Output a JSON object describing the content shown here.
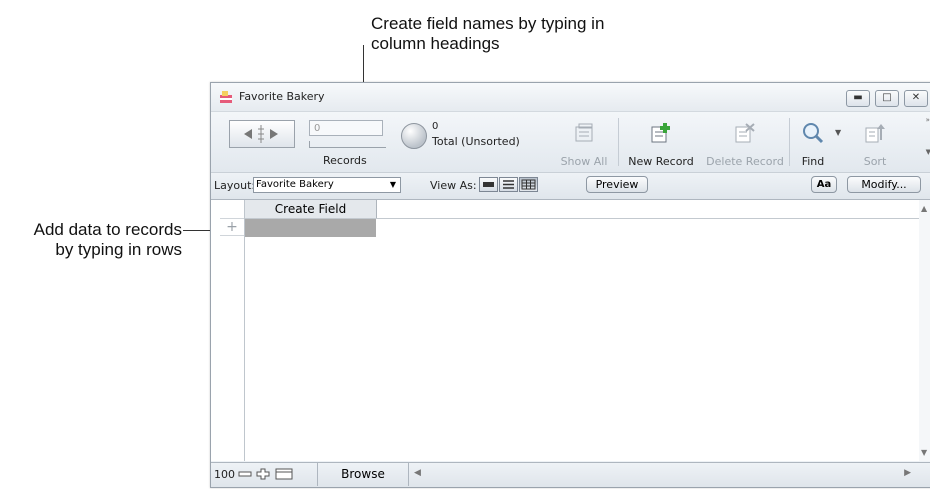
{
  "annotations": {
    "top_line1": "Create field names by typing in",
    "top_line2": "column headings",
    "left_line1": "Add data to records",
    "left_line2": "by typing in rows"
  },
  "window": {
    "title": "Favorite Bakery",
    "controls": [
      "minimize-icon",
      "maximize-icon",
      "close-icon"
    ]
  },
  "toolbar": {
    "record_field_value": "0",
    "records_label": "Records",
    "found_count": "0",
    "found_status": "Total (Unsorted)",
    "show_all": "Show All",
    "new_record": "New Record",
    "delete_record": "Delete Record",
    "find": "Find",
    "sort": "Sort"
  },
  "layoutbar": {
    "layout_label": "Layout:",
    "layout_value": "Favorite Bakery",
    "view_as_label": "View As:",
    "preview": "Preview",
    "format_button": "Aa",
    "modify": "Modify..."
  },
  "table": {
    "header": "Create Field",
    "add_row": "+"
  },
  "statusbar": {
    "zoom": "100",
    "mode": "Browse"
  },
  "colors": {
    "selected_row": "#a9a9a9",
    "header_bg": "#e4e8ec",
    "new_record_accent": "#3aa53a"
  }
}
